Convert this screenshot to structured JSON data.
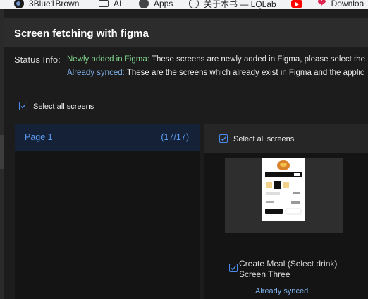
{
  "bookmarks": [
    {
      "label": "3Blue1Brown",
      "icon": "3blue1brown-icon"
    },
    {
      "label": "AI",
      "icon": "folder-icon"
    },
    {
      "label": "Apps",
      "icon": "globe-icon"
    },
    {
      "label": "关于本书 — LQLab",
      "icon": "face-icon"
    },
    {
      "label": "",
      "icon": "youtube-icon"
    },
    {
      "label": "Downloa",
      "icon": "heart-icon"
    }
  ],
  "dialog": {
    "title": "Screen fetching with figma",
    "status": {
      "label": "Status Info:",
      "newly_added_tag": "Newly added in Figma:",
      "newly_added_text": " These screens are newly added in Figma, please select the",
      "synced_tag": "Already synced:",
      "synced_text": " These are the screens which already exist in Figma and the applic"
    },
    "select_all_label": "Select all screens",
    "pages": [
      {
        "name": "Page 1",
        "count": "(17/17)"
      }
    ],
    "right": {
      "select_all_label": "Select all screens",
      "screens": [
        {
          "name": "Create Meal (Select drink) Screen Three",
          "status": "Already synced",
          "checked": true
        }
      ]
    }
  },
  "colors": {
    "accent": "#4a8cf0",
    "newly_added": "#7fd28c",
    "synced": "#7fb3ee"
  }
}
